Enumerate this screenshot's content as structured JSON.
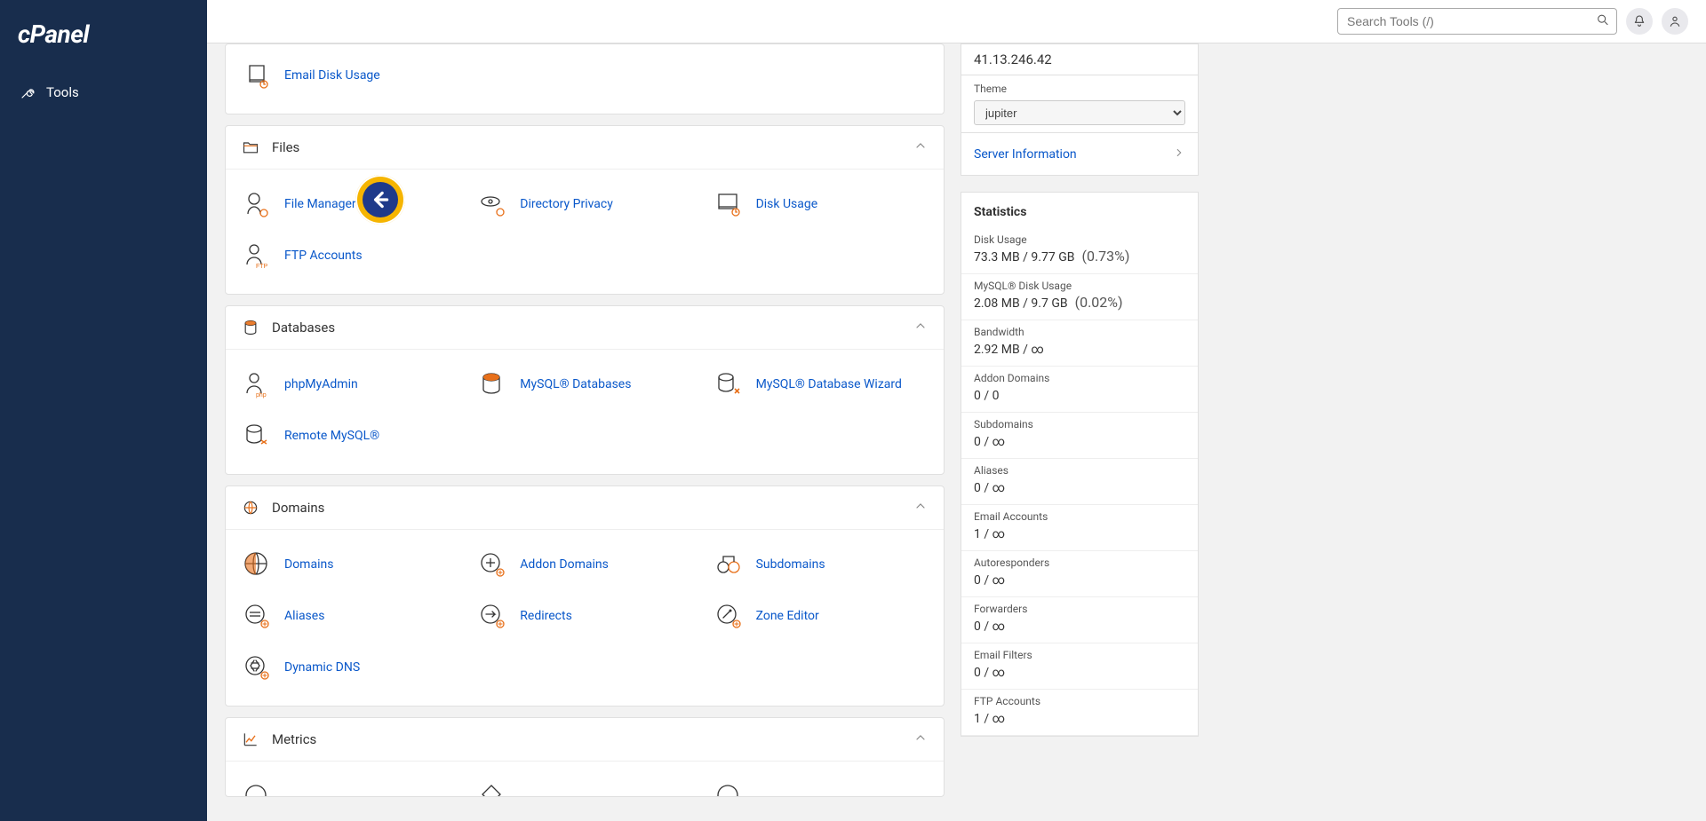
{
  "brand": "cPanel",
  "nav": {
    "tools_label": "Tools"
  },
  "search": {
    "placeholder": "Search Tools (/)"
  },
  "pointer_alt": "back-arrow",
  "sections": {
    "prev_tail_item": "Email Disk Usage",
    "files": {
      "title": "Files",
      "items": [
        "File Manager",
        "Directory Privacy",
        "Disk Usage",
        "FTP Accounts"
      ]
    },
    "databases": {
      "title": "Databases",
      "items": [
        "phpMyAdmin",
        "MySQL® Databases",
        "MySQL® Database Wizard",
        "Remote MySQL®"
      ]
    },
    "domains": {
      "title": "Domains",
      "items": [
        "Domains",
        "Addon Domains",
        "Subdomains",
        "Aliases",
        "Redirects",
        "Zone Editor",
        "Dynamic DNS"
      ]
    },
    "metrics": {
      "title": "Metrics"
    }
  },
  "info": {
    "ip_value": "41.13.246.42",
    "theme_label": "Theme",
    "theme_value": "jupiter",
    "server_info": "Server Information"
  },
  "stats": {
    "title": "Statistics",
    "rows": [
      {
        "label": "Disk Usage",
        "value": "73.3 MB / 9.77 GB",
        "pct": "(0.73%)"
      },
      {
        "label": "MySQL® Disk Usage",
        "value": "2.08 MB / 9.7 GB",
        "pct": "(0.02%)"
      },
      {
        "label": "Bandwidth",
        "value": "2.92 MB / ∞",
        "pct": ""
      },
      {
        "label": "Addon Domains",
        "value": "0 / 0",
        "pct": ""
      },
      {
        "label": "Subdomains",
        "value": "0 / ∞",
        "pct": ""
      },
      {
        "label": "Aliases",
        "value": "0 / ∞",
        "pct": ""
      },
      {
        "label": "Email Accounts",
        "value": "1 / ∞",
        "pct": ""
      },
      {
        "label": "Autoresponders",
        "value": "0 / ∞",
        "pct": ""
      },
      {
        "label": "Forwarders",
        "value": "0 / ∞",
        "pct": ""
      },
      {
        "label": "Email Filters",
        "value": "0 / ∞",
        "pct": ""
      },
      {
        "label": "FTP Accounts",
        "value": "1 / ∞",
        "pct": ""
      }
    ]
  }
}
